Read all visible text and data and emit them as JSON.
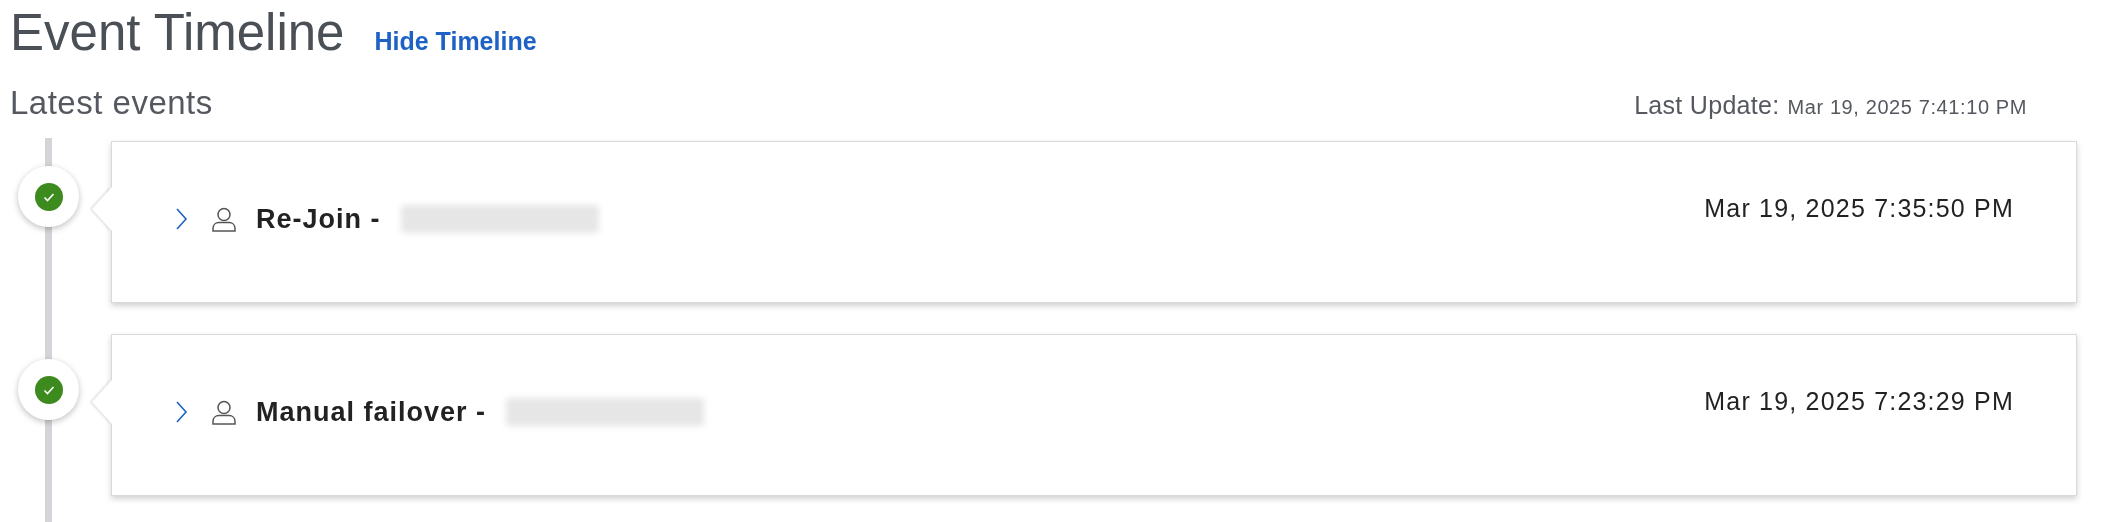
{
  "header": {
    "title": "Event Timeline",
    "toggle_link": "Hide Timeline"
  },
  "subheader": {
    "title": "Latest events",
    "last_update_label": "Last Update:",
    "last_update_value": "Mar 19, 2025 7:41:10 PM"
  },
  "events": [
    {
      "completed": true,
      "expanded": false,
      "title": "Re-Join -",
      "redacted": true,
      "time": "Mar 19, 2025 7:35:50 PM"
    },
    {
      "completed": true,
      "expanded": false,
      "title": "Manual failover -",
      "redacted": true,
      "time": "Mar 19, 2025 7:23:29 PM"
    }
  ]
}
